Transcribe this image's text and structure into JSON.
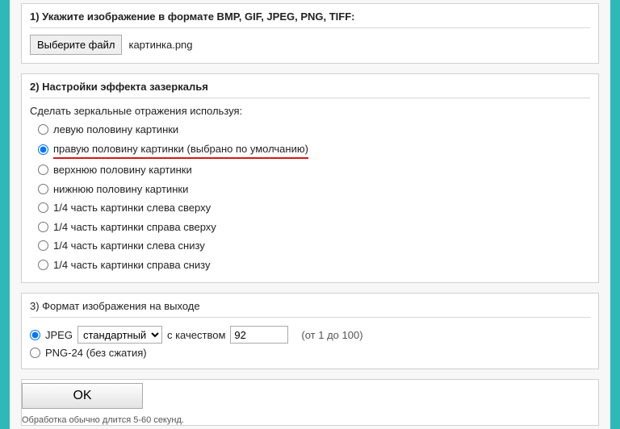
{
  "section1": {
    "title": "1) Укажите изображение в формате BMP, GIF, JPEG, PNG, TIFF:",
    "choose_file_label": "Выберите файл",
    "filename": "картинка.png"
  },
  "section2": {
    "title": "2) Настройки эффекта зазеркалья",
    "instruction": "Сделать зеркальные отражения используя:",
    "options": {
      "o1": "левую половину картинки",
      "o2": "правую половину картинки (выбрано по умолчанию)",
      "o3": "верхнюю половину картинки",
      "o4": "нижнюю половину картинки",
      "o5": "1/4 часть картинки слева сверху",
      "o6": "1/4 часть картинки справа сверху",
      "o7": "1/4 часть картинки слева снизу",
      "o8": "1/4 часть картинки справа снизу"
    }
  },
  "section3": {
    "title": "3) Формат изображения на выходе",
    "jpeg_label": "JPEG",
    "quality_select": "стандартный",
    "quality_label": "с качеством",
    "quality_value": "92",
    "quality_hint": "(от 1 до 100)",
    "png_label": "PNG-24 (без сжатия)"
  },
  "submit": {
    "ok_label": "OK",
    "footnote": "Обработка обычно длится 5-60 секунд."
  }
}
